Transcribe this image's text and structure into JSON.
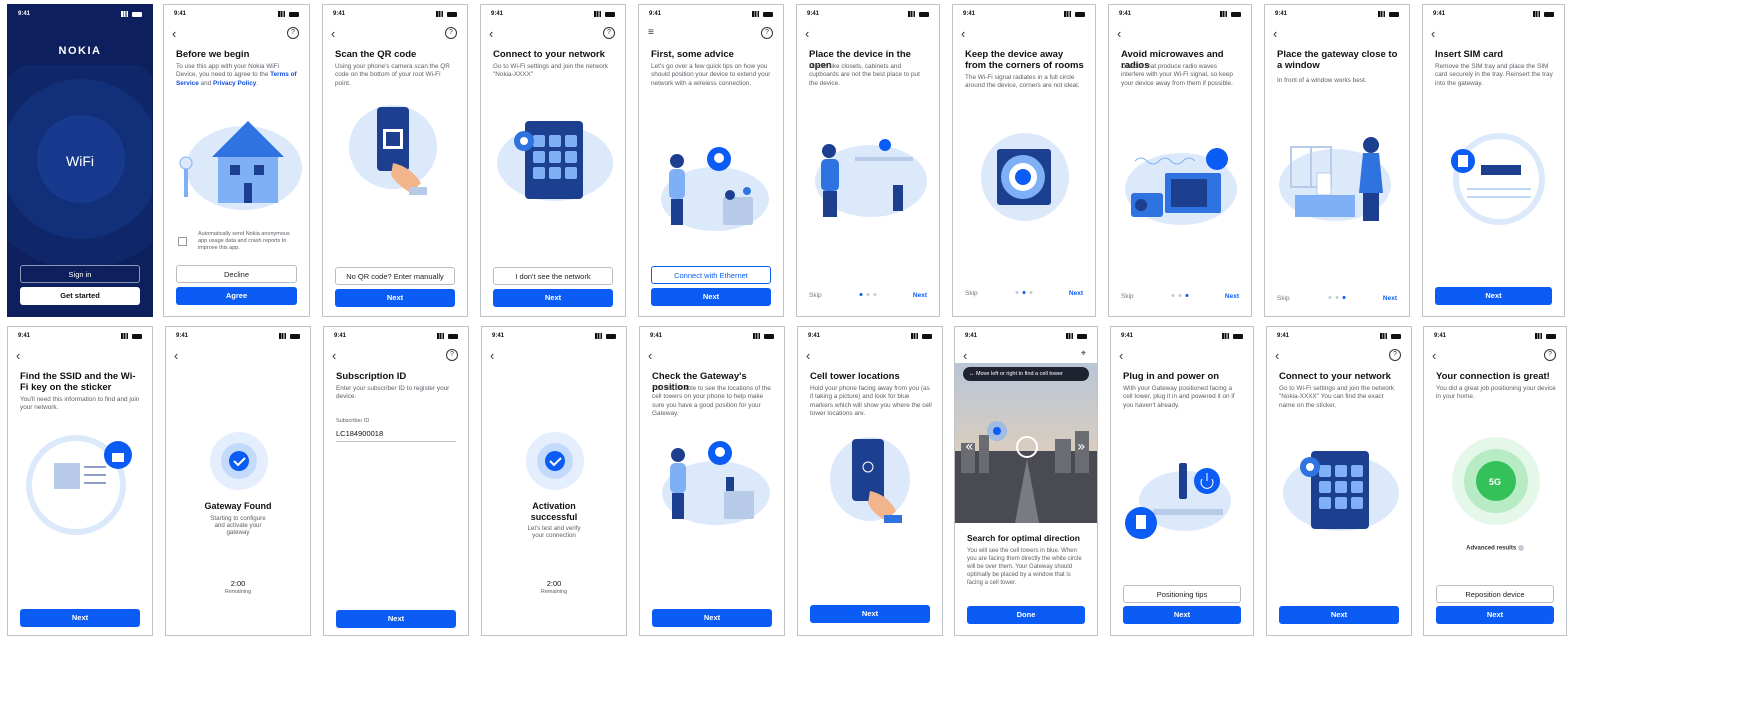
{
  "status_time": "9:41",
  "common": {
    "next": "Next",
    "skip": "Skip"
  },
  "s1": {
    "logo": "NOKIA",
    "center": "WiFi",
    "signin": "Sign in",
    "get_started": "Get started"
  },
  "s2": {
    "title": "Before we begin",
    "desc_pre": "To use this app with your Nokia WiFi Device, you need to agree to the ",
    "terms": "Terms of Service",
    "and": " and ",
    "privacy": "Privacy Policy",
    "dot": ".",
    "checkbox": "Automatically send Nokia anonymous app usage data and crash reports to improve this app.",
    "decline": "Decline",
    "agree": "Agree"
  },
  "s3": {
    "title": "Scan the QR code",
    "desc": "Using your phone's camera scan the QR code on the bottom of your root Wi-Fi point.",
    "manual": "No QR code? Enter manually"
  },
  "s4": {
    "title": "Connect to your network",
    "desc": "Go to Wi-Fi settings and join the network \"Nokia-XXXX\"",
    "no_network": "I don't see the network"
  },
  "s5": {
    "title": "First, some advice",
    "desc": "Let's go over a few quick tips on how you should position your device to extend your network with a wireless connection.",
    "ethernet": "Connect with Ethernet"
  },
  "s6": {
    "title": "Place the device in the open",
    "desc": "Places like closets, cabinets and cupboards are not the best place to put the device."
  },
  "s7": {
    "title": "Keep the device away from the corners of rooms",
    "desc": "The Wi-Fi signal radiates in a full circle around the device, corners are not ideal."
  },
  "s8": {
    "title": "Avoid microwaves and radios",
    "desc": "Devices that produce radio waves interfere with your Wi-Fi signal, so keep your device away from them if possible."
  },
  "s9": {
    "title": "Place the gateway close to a window",
    "desc": "In front of a window works best."
  },
  "s10": {
    "title": "Insert SIM card",
    "desc": "Remove the SIM tray and place the SIM card securely in the tray. Reinsert the tray into the gateway."
  },
  "s11": {
    "title": "Find the SSID and the Wi-Fi key on the sticker",
    "desc": "You'll need this information to find and join your network."
  },
  "s12": {
    "title": "Gateway Found",
    "desc": "Starting to configure and activate your gateway",
    "timer": "2:00",
    "remaining": "Remaining"
  },
  "s13": {
    "title": "Subscription ID",
    "desc": "Enter your subscriber ID to register your device.",
    "label": "Subscriber ID",
    "value": "LC184900018"
  },
  "s14": {
    "title": "Activation successful",
    "desc": "Let's test and verify your connection",
    "timer": "2:00",
    "remaining": "Remaining"
  },
  "s15": {
    "title": "Check the Gateway's position",
    "desc": "You will be able to see the locations of the cell towers on your phone to help make sure you have a good position for your Gateway."
  },
  "s16": {
    "title": "Cell tower locations",
    "desc": "Hold your phone facing away from you (as if taking a picture) and look for blue markers which will show you where the cell tower locations are."
  },
  "s17": {
    "banner": "Move left or right to find a cell tower",
    "title": "Search for optimal direction",
    "desc": "You will see the cell towers in blue. When you are facing them directly the white circle will be over them. Your Gateway should optimally be placed by a window that is facing a cell tower.",
    "done": "Done"
  },
  "s18": {
    "title": "Plug in and power on",
    "desc": "With your Gateway positioned facing a cell tower, plug it in and powered it on if you haven't already.",
    "tips": "Positioning tips"
  },
  "s19": {
    "title": "Connect to your network",
    "desc": "Go to Wi-Fi settings and join the network \"Nokia-XXXX\" You can find the exact name on the sticker."
  },
  "s20": {
    "title": "Your connection is great!",
    "desc": "You did a great job positioning your device in your home.",
    "badge": "5G",
    "advanced": "Advanced results",
    "reposition": "Reposition device"
  },
  "colors": {
    "primary": "#0a5cf5",
    "dark_bg": "#0d1f5c",
    "illus_light": "#dce9fb",
    "illus_mid": "#7fb0f5",
    "illus_dark": "#1d3f8f"
  }
}
